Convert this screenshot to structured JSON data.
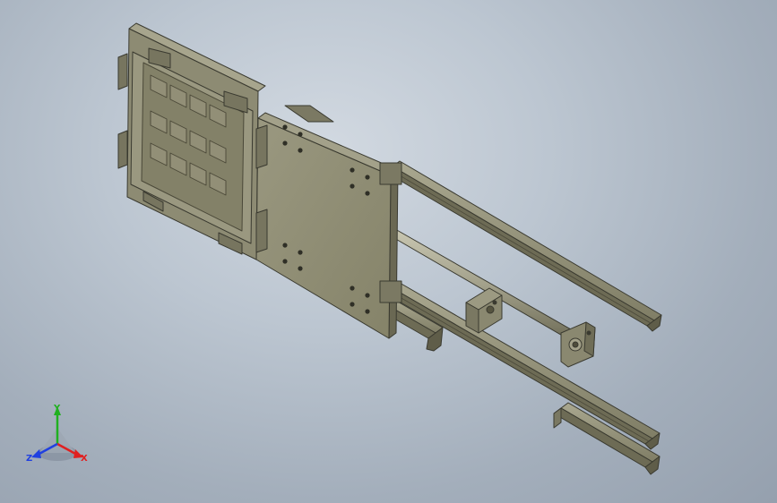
{
  "viewport": {
    "background_top": "#d2d9e1",
    "background_bottom": "#95a0ae",
    "model_color": "#8e8c74",
    "edge_color": "#3a3a30"
  },
  "triad": {
    "x_label": "X",
    "y_label": "Y",
    "z_label": "Z",
    "x_color": "#e02020",
    "y_color": "#20b020",
    "z_color": "#2040e0"
  }
}
